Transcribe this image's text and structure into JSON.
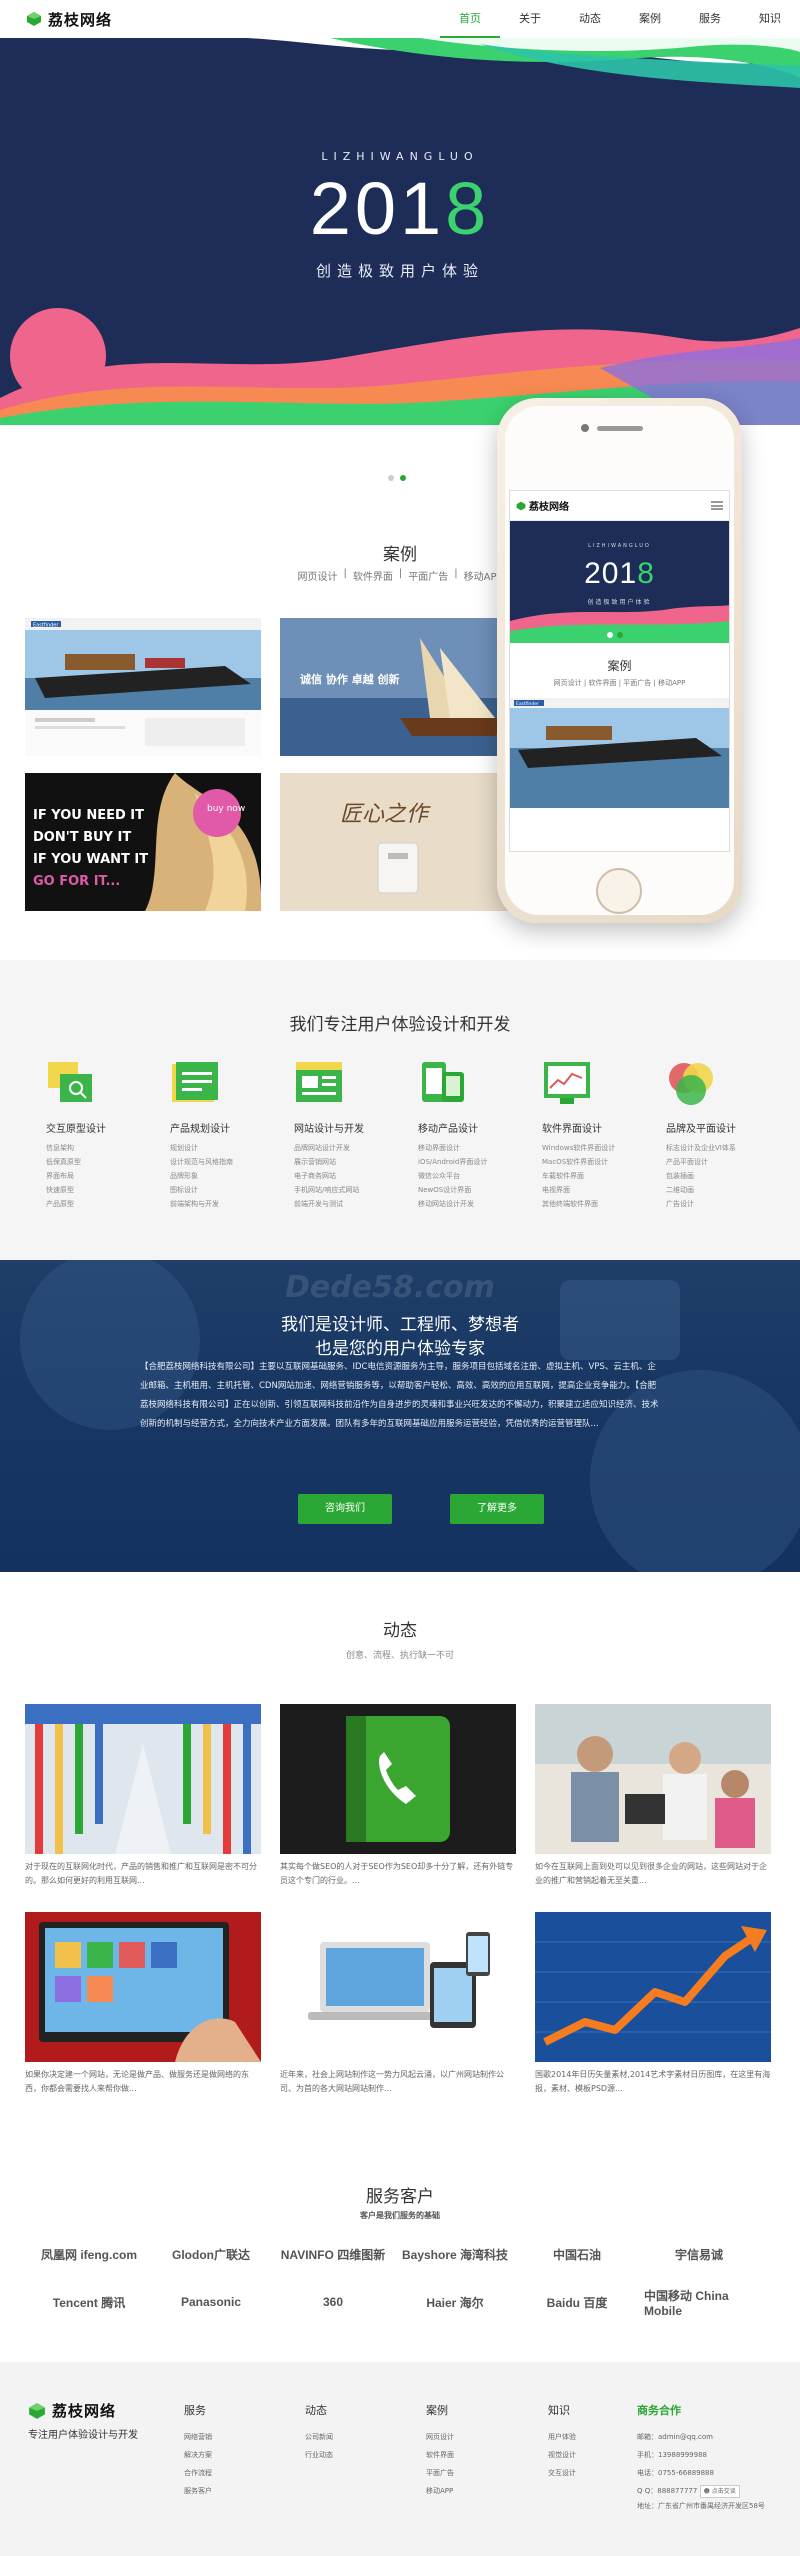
{
  "header": {
    "logo": "荔枝网络",
    "nav": [
      "首页",
      "关于",
      "动态",
      "案例",
      "服务",
      "知识"
    ]
  },
  "hero": {
    "subtitle": "LIZHIWANGLUO",
    "year_main": "201",
    "year_accent": "8",
    "slogan": "创造极致用户体验"
  },
  "cases": {
    "title": "案例",
    "tabs": [
      "网页设计",
      "|",
      "软件界面",
      "|",
      "平面广告",
      "|",
      "移动APP"
    ],
    "items": [
      {
        "name": "ship-website",
        "text": "Eastfinder"
      },
      {
        "name": "enterprise-culture",
        "text": "诚信 协作 卓越 创新"
      },
      {
        "name": "hair-ad",
        "text": "IF YOU NEED IT DON'T BUY IT IF YOU WANT IT GO FOR IT...",
        "badge": "buy now"
      },
      {
        "name": "craftsman-product",
        "text": "匠心之作"
      }
    ]
  },
  "phone": {
    "logo": "荔枝网络",
    "subtitle": "LIZHIWANGLUO",
    "year_main": "201",
    "year_accent": "8",
    "slogan": "创造极致用户体验",
    "cases_title": "案例",
    "cases_tabs": "网页设计 | 软件界面 | 平面广告 | 移动APP",
    "ship_text": "Eastfinder"
  },
  "services": {
    "title": "我们专注用户体验设计和开发",
    "items": [
      {
        "title": "交互原型设计",
        "icon": "prototype-icon",
        "list": [
          "信息架构",
          "低保真原型",
          "界面布局",
          "快速原型",
          "产品原型"
        ]
      },
      {
        "title": "产品规划设计",
        "icon": "planning-icon",
        "list": [
          "规划设计",
          "设计规范与风格指南",
          "品牌形象",
          "图标设计",
          "前端架构与开发"
        ]
      },
      {
        "title": "网站设计与开发",
        "icon": "website-icon",
        "list": [
          "品牌网站设计开发",
          "展示营销网站",
          "电子商务网站",
          "手机网站/响应式网站",
          "前端开发与测试"
        ]
      },
      {
        "title": "移动产品设计",
        "icon": "mobile-icon",
        "list": [
          "移动界面设计",
          "iOS/Android界面设计",
          "微信公众平台",
          "NewOS设计界面",
          "移动网站设计开发"
        ]
      },
      {
        "title": "软件界面设计",
        "icon": "software-icon",
        "list": [
          "Windows软件界面设计",
          "MacOS软件界面设计",
          "车载软件界面",
          "电视界面",
          "其他终端软件界面"
        ]
      },
      {
        "title": "品牌及平面设计",
        "icon": "brand-icon",
        "list": [
          "标志设计及企业VI体系",
          "产品平面设计",
          "包装插画",
          "二维动画",
          "广告设计"
        ]
      }
    ]
  },
  "about": {
    "watermark": "Dede58.com",
    "title_line1": "我们是设计师、工程师、梦想者",
    "title_line2": "也是您的用户体验专家",
    "text": "【合肥荔枝网络科技有限公司】主要以互联网基础服务、IDC电信资源服务为主导，服务项目包括域名注册、虚拟主机、VPS、云主机、企业邮箱、主机租用、主机托管、CDN网站加速、网络营销服务等，以帮助客户轻松、高效、高效的应用互联网，提高企业竞争能力。【合肥荔枝网络科技有限公司】正在以创新、引领互联网科技前沿作为自身进步的灵魂和事业兴旺发达的不懈动力，积聚建立适应知识经济、技术创新的机制与经营方式，全力向技术产业方面发展。团队有多年的互联网基础应用服务运营经验，凭借优秀的运营管理队...",
    "btn_contact": "咨询我们",
    "btn_more": "了解更多"
  },
  "news": {
    "title": "动态",
    "subtitle": "创意、流程、执行缺一不可",
    "items": [
      {
        "name": "pipes",
        "text": "对于现在的互联网化时代，产品的销售和推广和互联网是密不可分的。那么如何更好的利用互联网..."
      },
      {
        "name": "phone-book",
        "text": "其实每个做SEO的人对于SEO作为SEO却多十分了解，还有外链专员这个专门的行业。..."
      },
      {
        "name": "office-people",
        "text": "如今在互联网上面到处可以见到很多企业的网站，这些网站对于企业的推广和营销起着无至关重..."
      },
      {
        "name": "tv-apps",
        "text": "如果你决定建一个网站，无论是做产品、做服务还是做网络的东西，你都会需要找人来帮你做..."
      },
      {
        "name": "devices",
        "text": "近年来，社会上网站制作这一势力风起云涌，以广州网站制作公司、为首的各大网站网站制作..."
      },
      {
        "name": "growth-chart",
        "text": "国歌2014年日历矢量素材,2014艺术字素材日历图库，在这里有海报，素材、模板PSD源..."
      }
    ]
  },
  "clients": {
    "title": "服务客户",
    "subtitle": "客户是我们服务的基础",
    "logos": [
      "凤凰网 ifeng.com",
      "Glodon广联达",
      "NAVINFO 四维图新",
      "Bayshore 海湾科技",
      "中国石油",
      "宇信易诚",
      "Tencent 腾讯",
      "Panasonic",
      "360",
      "Haier 海尔",
      "Baidu 百度",
      "中国移动 China Mobile"
    ]
  },
  "footer": {
    "logo": "荔枝网络",
    "slogan": "专注用户体验设计与开发",
    "columns": [
      {
        "title": "服务",
        "items": [
          "网络营销",
          "解决方案",
          "合作流程",
          "服务客户"
        ]
      },
      {
        "title": "动态",
        "items": [
          "公司新闻",
          "行业动态"
        ]
      },
      {
        "title": "案例",
        "items": [
          "网页设计",
          "软件界面",
          "平面广告",
          "移动APP"
        ]
      },
      {
        "title": "知识",
        "items": [
          "用户体验",
          "视觉设计",
          "交互设计"
        ]
      }
    ],
    "contact": {
      "title": "商务合作",
      "items": [
        "邮箱：admin@qq.com",
        "手机：13988999988",
        "电话：0755-66889888",
        "Q Q：888877777",
        "地址：广东省广州市番禺经济开发区58号"
      ],
      "chat": "点击交谈"
    }
  },
  "colors": {
    "accent": "#2aa735",
    "hero_bg": "#1d2d58",
    "about_bg": "#183763"
  }
}
